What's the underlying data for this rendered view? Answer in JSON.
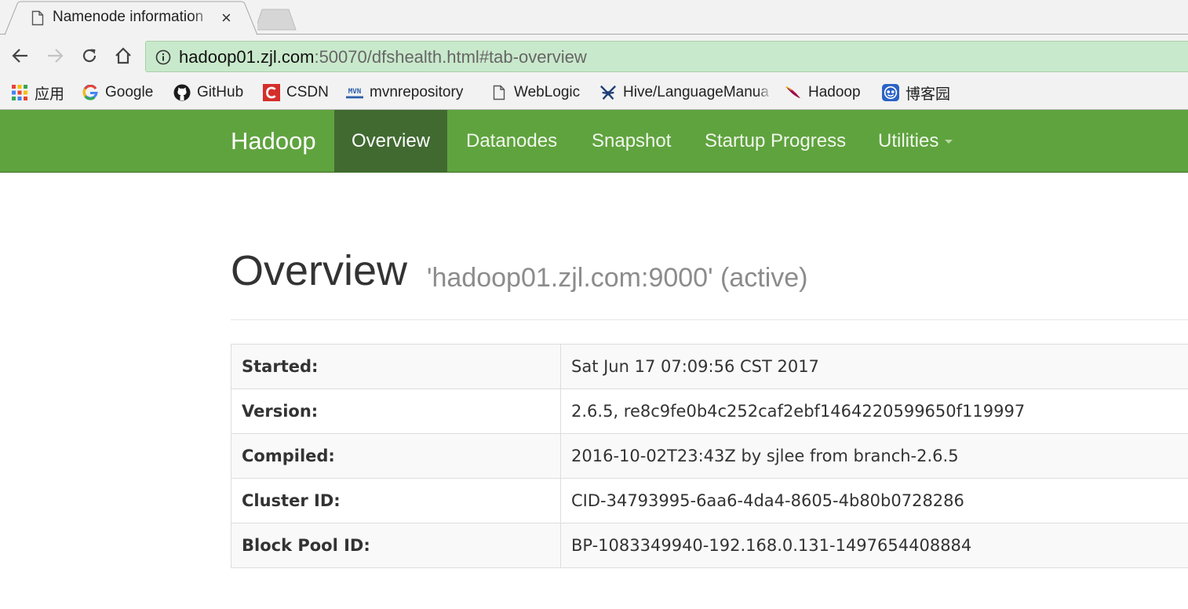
{
  "browser": {
    "tab": {
      "title": "Namenode information"
    },
    "address": {
      "host": "hadoop01.zjl.com",
      "rest": ":50070/dfshealth.html#tab-overview"
    },
    "bookmarks": [
      {
        "label": "应用",
        "icon": "apps-grid-icon"
      },
      {
        "label": "Google",
        "icon": "google-icon"
      },
      {
        "label": "GitHub",
        "icon": "github-icon"
      },
      {
        "label": "CSDN",
        "icon": "csdn-icon"
      },
      {
        "label": "mvnrepository",
        "icon": "mvn-icon"
      },
      {
        "label": "WebLogic",
        "icon": "page-icon"
      },
      {
        "label": "Hive/LanguageManual",
        "icon": "hive-icon"
      },
      {
        "label": "Hadoop",
        "icon": "hadoop-feather-icon"
      },
      {
        "label": "博客园",
        "icon": "cnblogs-icon"
      }
    ]
  },
  "navbar": {
    "brand": "Hadoop",
    "items": [
      {
        "label": "Overview",
        "active": true
      },
      {
        "label": "Datanodes"
      },
      {
        "label": "Snapshot"
      },
      {
        "label": "Startup Progress"
      },
      {
        "label": "Utilities",
        "dropdown": true
      }
    ]
  },
  "overview": {
    "title": "Overview",
    "subtitle": "'hadoop01.zjl.com:9000' (active)",
    "rows": [
      {
        "label": "Started:",
        "value": "Sat Jun 17 07:09:56 CST 2017"
      },
      {
        "label": "Version:",
        "value": "2.6.5, re8c9fe0b4c252caf2ebf1464220599650f119997"
      },
      {
        "label": "Compiled:",
        "value": "2016-10-02T23:43Z by sjlee from branch-2.6.5"
      },
      {
        "label": "Cluster ID:",
        "value": "CID-34793995-6aa6-4da4-8605-4b80b0728286"
      },
      {
        "label": "Block Pool ID:",
        "value": "BP-1083349940-192.168.0.131-1497654408884"
      }
    ]
  },
  "colors": {
    "navbar": "#5fa33e",
    "navbar_active": "#416a31",
    "omnibox_secure": "#c9e9cc"
  }
}
